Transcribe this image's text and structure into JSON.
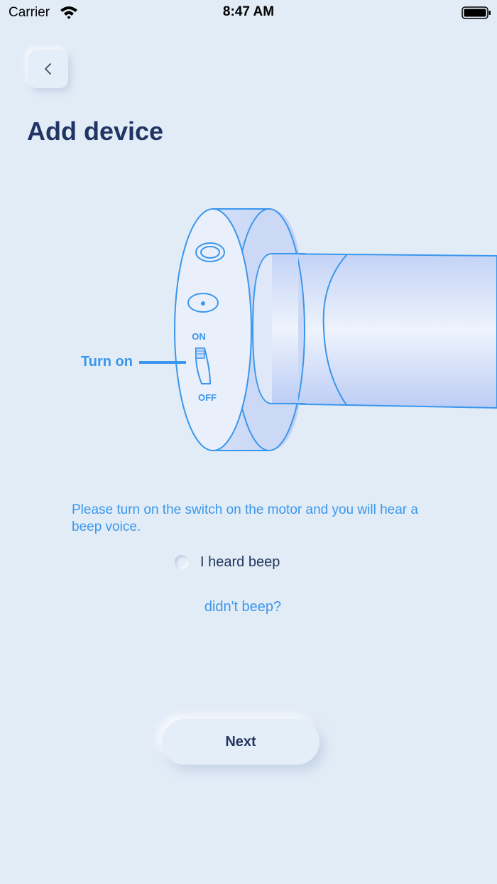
{
  "status_bar": {
    "carrier": "Carrier",
    "time": "8:47 AM"
  },
  "header": {
    "back_icon": "chevron-left-icon",
    "title": "Add device"
  },
  "illustration": {
    "switch_on_label": "ON",
    "switch_off_label": "OFF",
    "pointer_label": "Turn on"
  },
  "instruction": "Please turn on the switch on the motor and you will hear a beep voice.",
  "beep_option": {
    "label": "I heard beep",
    "checked": false
  },
  "didnt_beep_link": "didn't beep?",
  "next_button": "Next",
  "colors": {
    "background": "#e2ecf7",
    "accent": "#3a97ec",
    "title": "#203564"
  }
}
